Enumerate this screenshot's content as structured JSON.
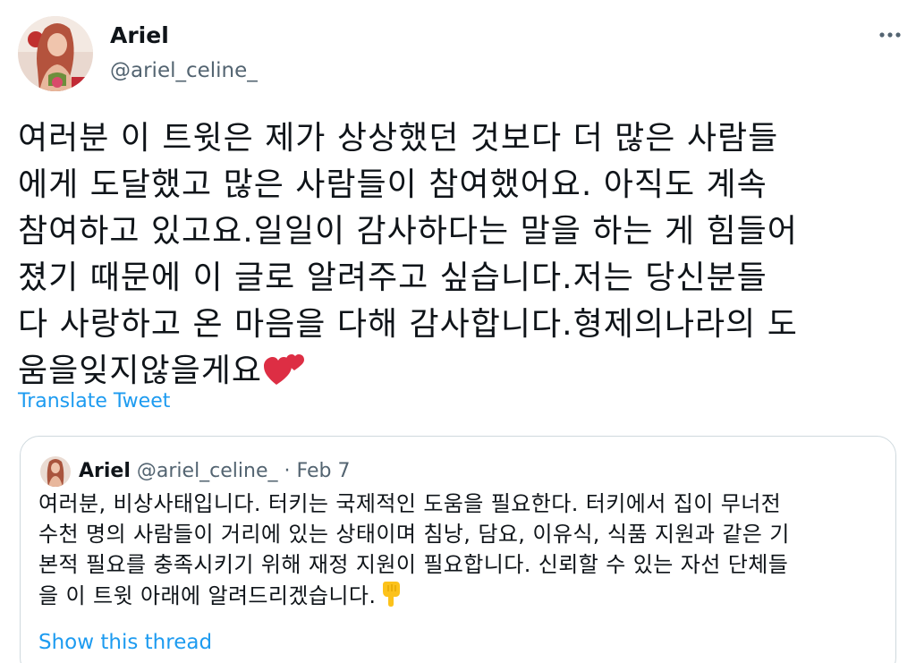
{
  "tweet": {
    "author": {
      "display_name": "Ariel",
      "handle": "@ariel_celine_"
    },
    "more_icon": "more-horizontal-icon",
    "text_lines": [
      "여러분 이 트윗은 제가 상상했던 것보다 더 많은 사람들",
      "에게 도달했고 많은 사람들이 참여했어요. 아직도 계속",
      "참여하고 있고요.일일이 감사하다는 말을 하는 게 힘들어",
      "졌기 때문에 이 글로 알려주고 싶습니다.저는 당신분들",
      "다 사랑하고 온 마음을 다해 감사합니다.형제의나라의 도",
      "움을잊지않을게요"
    ],
    "emoji": "two-hearts-icon",
    "translate_label": "Translate Tweet"
  },
  "quoted_tweet": {
    "display_name": "Ariel",
    "handle": "@ariel_celine_",
    "separator": "·",
    "date": "Feb 7",
    "text_lines": [
      "여러분, 비상사태입니다. 터키는 국제적인 도움을 필요한다. 터키에서 집이 무너전",
      "수천 명의 사람들이 거리에 있는 상태이며 침낭, 담요, 이유식, 식품 지원과 같은 기",
      "본적 필요를 충족시키기 위해 재정 지원이 필요합니다. 신뢰할 수 있는 자선 단체들",
      "을 이 트윗 아래에 알려드리겠습니다."
    ],
    "emoji": "backhand-index-pointing-down-icon",
    "show_thread_label": "Show this thread"
  },
  "colors": {
    "text_primary": "#0f1419",
    "text_secondary": "#536471",
    "link_blue": "#1d9bf0",
    "border": "#cfd9de",
    "heart_red": "#dd2e44"
  }
}
